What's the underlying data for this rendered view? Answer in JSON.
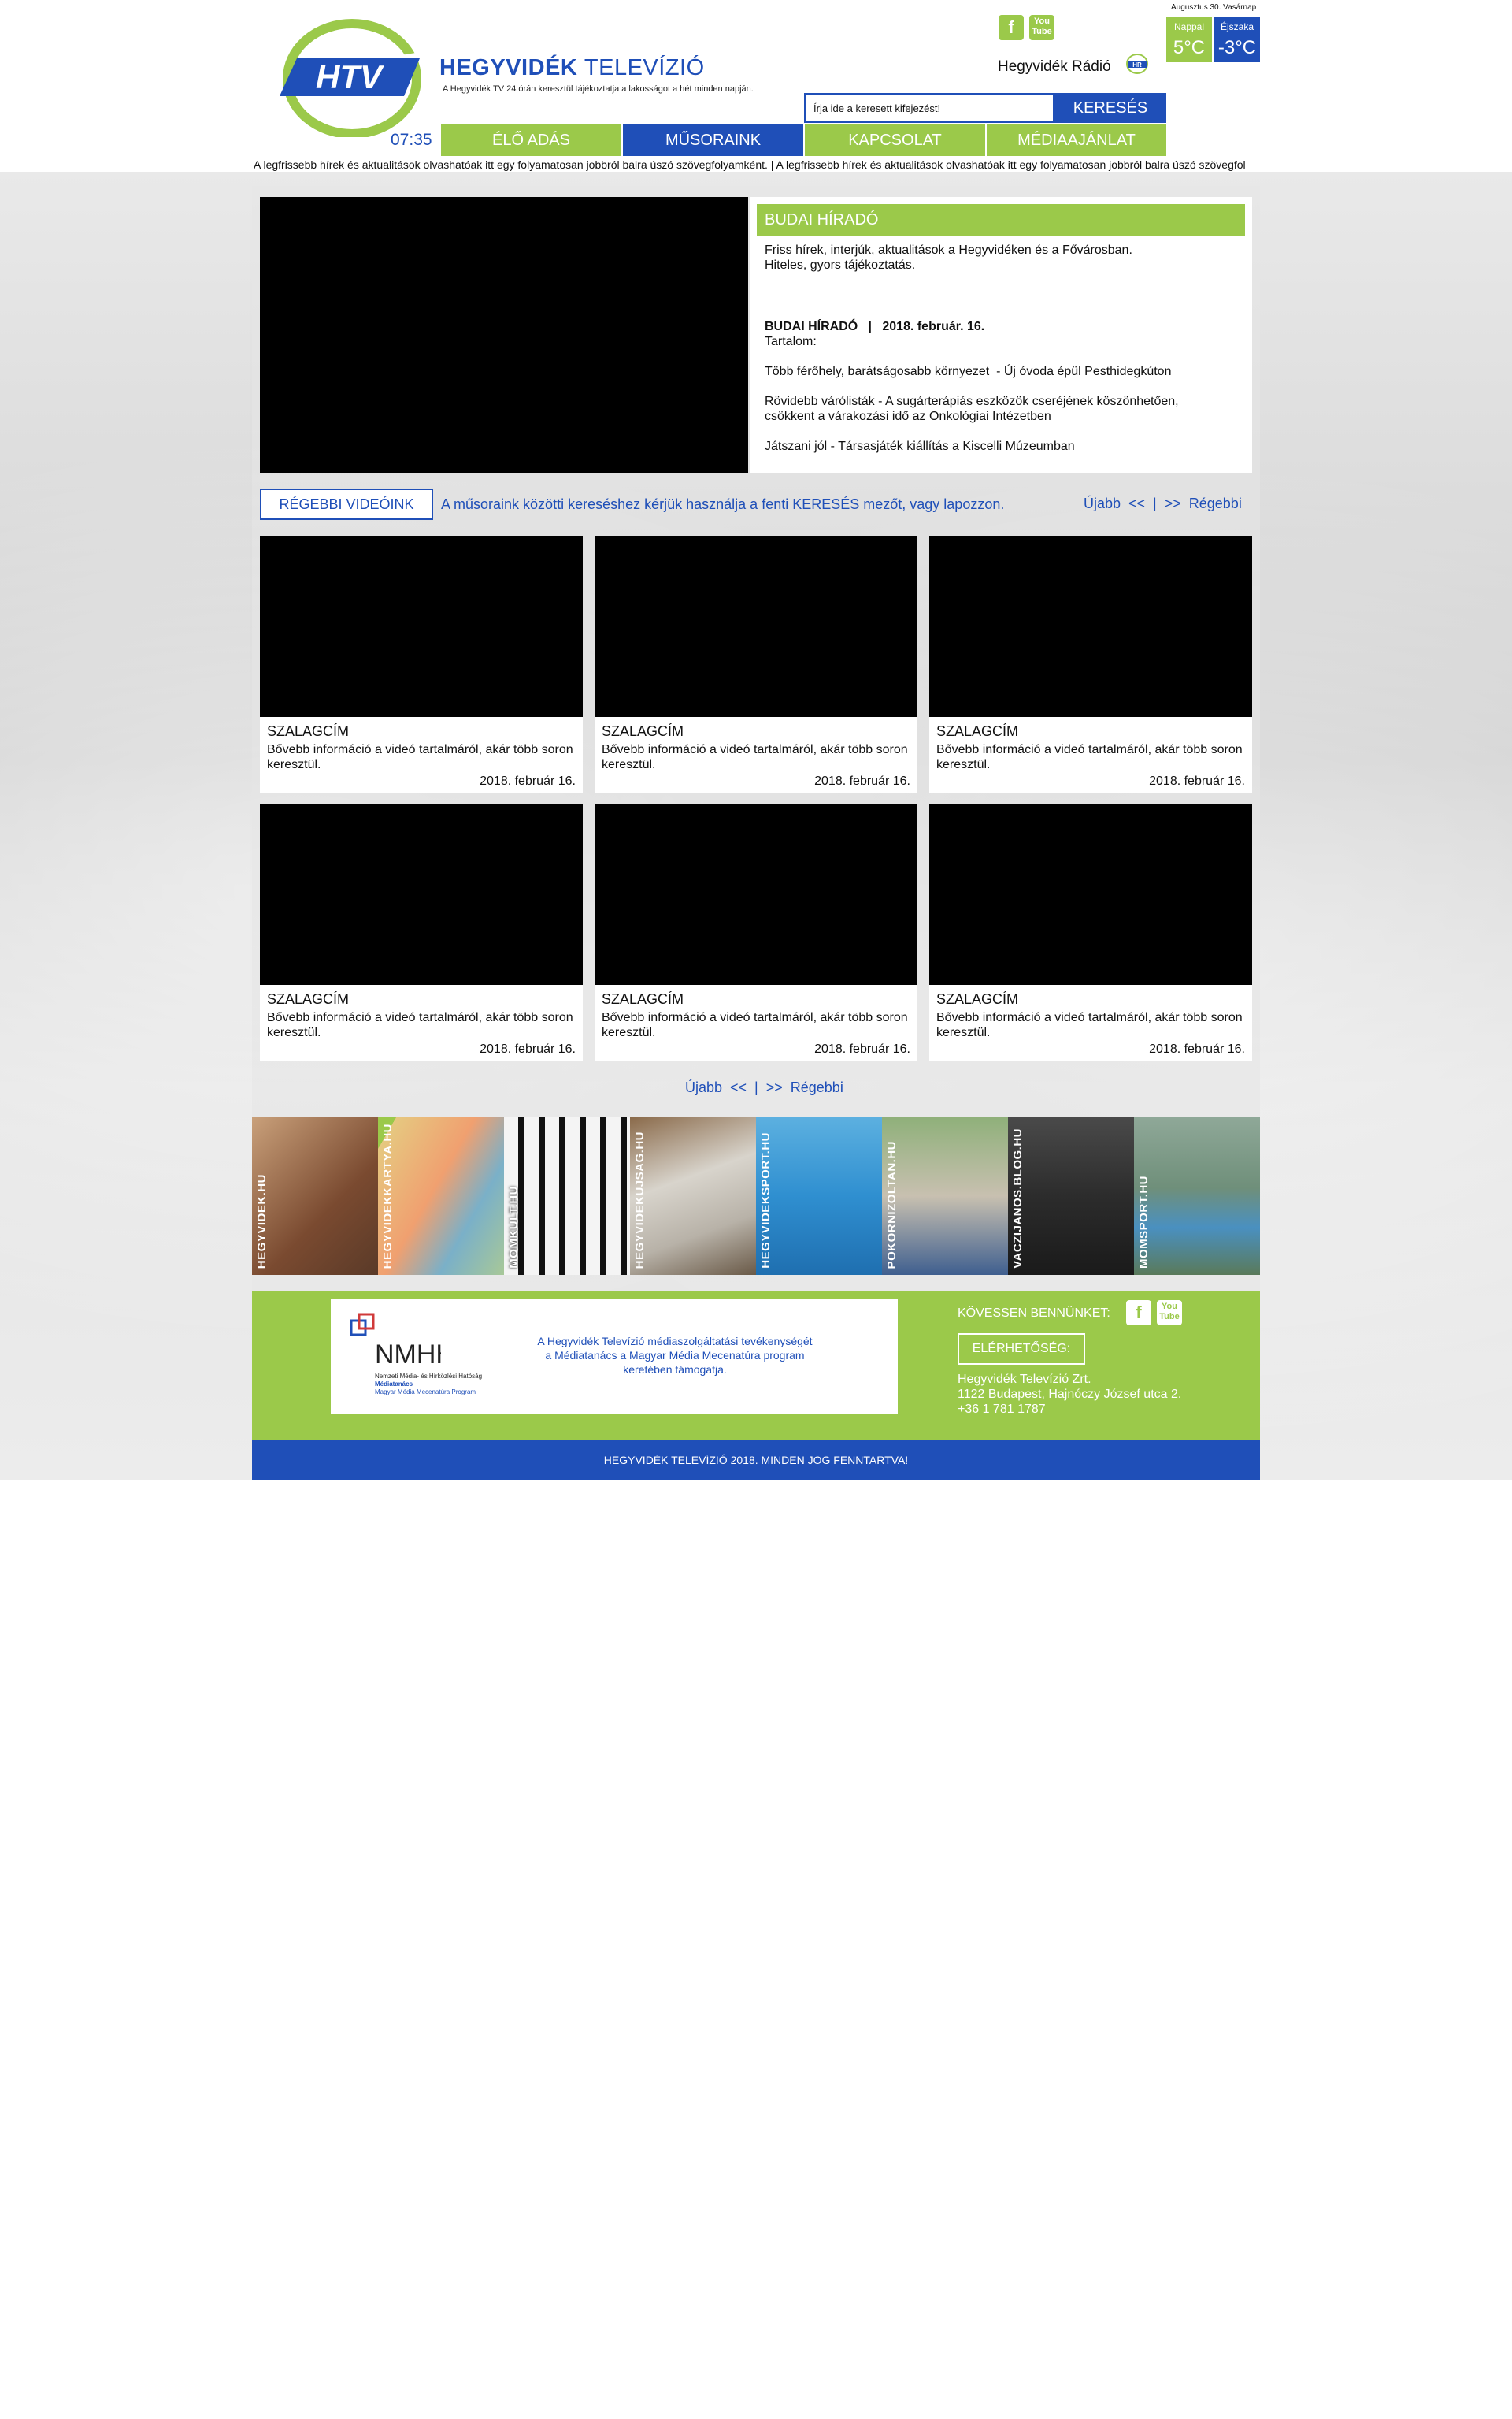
{
  "header": {
    "title_bold": "HEGYVIDÉK",
    "title_light": "TELEVÍZIÓ",
    "logo_text": "HTV",
    "tagline": "A Hegyvidék TV 24 órán keresztül tájékoztatja a lakosságot a hét minden napján.",
    "clock": "07:35",
    "date": "Augusztus 30. Vasárnap",
    "radio_label": "Hegyvidék Rádió",
    "radio_icon_text": "HR",
    "facebook_icon": "f",
    "youtube_icon": "You Tube",
    "weather": {
      "day_label": "Nappal",
      "day_temp": "5°C",
      "night_label": "Éjszaka",
      "night_temp": "-3°C"
    },
    "search": {
      "placeholder": "Írja ide a keresett kifejezést!",
      "button": "KERESÉS"
    },
    "nav": [
      {
        "label": "ÉLŐ ADÁS",
        "color": "#9bc94a"
      },
      {
        "label": "MŰSORAINK",
        "color": "#1f4fb8"
      },
      {
        "label": "KAPCSOLAT",
        "color": "#9bc94a"
      },
      {
        "label": "MÉDIAAJÁNLAT",
        "color": "#9bc94a"
      }
    ],
    "ticker": "A legfrissebb hírek és aktualitások olvashatóak itt egy folyamatosan jobbról balra úszó szövegfolyamként.   |   A legfrissebb hírek és aktualitások olvashatóak itt egy folyamatosan jobbról balra úszó szövegfol"
  },
  "feature": {
    "title": "BUDAI HÍRADÓ",
    "description_1": "Friss hírek, interjúk, aktualitások a Hegyvidéken és a Fővárosban.",
    "description_2": "Hiteles, gyors tájékoztatás.",
    "episode": "BUDAI HÍRADÓ   |   2018. február. 16.",
    "contents_label": "Tartalom:",
    "item_1": "Több férőhely, barátságosabb környezet  - Új óvoda épül Pesthidegkúton",
    "item_2a": "Rövidebb várólisták - A sugárterápiás eszközök cseréjének köszönhetően,",
    "item_2b": "csökkent a várakozási idő az Onkológiai Intézetben",
    "item_3": "Játszani jól - Társasjáték kiállítás a Kiscelli Múzeumban"
  },
  "videos": {
    "more_button": "RÉGEBBI VIDEÓINK",
    "hint": "A műsoraink közötti kereséshez kérjük használja a fenti KERESÉS mezőt, vagy lapozzon.",
    "pager": "Újabb  <<  |  >>  Régebbi",
    "cards": [
      {
        "title": "SZALAGCÍM",
        "desc": "Bővebb információ a videó tartalmáról, akár több soron keresztül.",
        "date": "2018. február 16."
      },
      {
        "title": "SZALAGCÍM",
        "desc": "Bővebb információ a videó tartalmáról, akár több soron keresztül.",
        "date": "2018. február 16."
      },
      {
        "title": "SZALAGCÍM",
        "desc": "Bővebb információ a videó tartalmáról, akár több soron keresztül.",
        "date": "2018. február 16."
      },
      {
        "title": "SZALAGCÍM",
        "desc": "Bővebb információ a videó tartalmáról, akár több soron keresztül.",
        "date": "2018. február 16."
      },
      {
        "title": "SZALAGCÍM",
        "desc": "Bővebb információ a videó tartalmáról, akár több soron keresztül.",
        "date": "2018. február 16."
      },
      {
        "title": "SZALAGCÍM",
        "desc": "Bővebb információ a videó tartalmáról, akár több soron keresztül.",
        "date": "2018. február 16."
      }
    ]
  },
  "banners": [
    {
      "label": "HEGYVIDEK.HU",
      "color": "#8a5a3c"
    },
    {
      "label": "HEGYVIDEKKARTYA.HU",
      "color": "#9bc94a"
    },
    {
      "label": "MOMKULT.HU",
      "color": "#1a1a1a"
    },
    {
      "label": "HEGYVIDEKUJSAG.HU",
      "color": "#8a6a4a"
    },
    {
      "label": "HEGYVIDEKSPORT.HU",
      "color": "#2f8fd0"
    },
    {
      "label": "POKORNIZOLTAN.HU",
      "color": "#6a8f5a"
    },
    {
      "label": "VACZIJANOS.BLOG.HU",
      "color": "#2c2c2c"
    },
    {
      "label": "MOMSPORT.HU",
      "color": "#6f8f7a"
    }
  ],
  "footer": {
    "nmhh_logo": "NMHH",
    "nmhh_name_1": "Nemzeti Média- és Hírközlési Hatóság",
    "nmhh_name_2": "Médiatanács",
    "nmhh_name_3": "Magyar Média Mecenatúra Program",
    "nmhh_text": "A Hegyvidék Televízió médiaszolgáltatási tevékenységét a Médiatanács a Magyar Média Mecenatúra program keretében támogatja.",
    "follow": "KÖVESSEN BENNÜNKET:",
    "contact_button": "ELÉRHETŐSÉG:",
    "company": "Hegyvidék Televízió Zrt.",
    "address": "1122 Budapest, Hajnóczy József utca 2.",
    "phone": "+36 1 781 1787",
    "copyright": "HEGYVIDÉK TELEVÍZIÓ 2018. MINDEN JOG FENNTARTVA!"
  }
}
